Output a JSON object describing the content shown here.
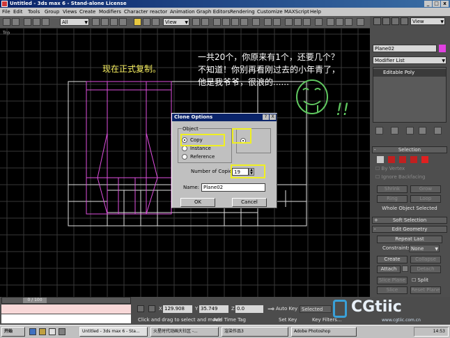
{
  "window": {
    "title": "Untitled - 3ds max 6 - Stand-alone License"
  },
  "menu": [
    "File",
    "Edit",
    "Tools",
    "Group",
    "Views",
    "Create",
    "Modifiers",
    "Character",
    "reactor",
    "Animation",
    "Graph Editors",
    "Rendering",
    "Customize",
    "MAXScript",
    "Help"
  ],
  "toolbar": {
    "selection_filter": "All",
    "ref_coord": "View",
    "ref_coord_right": "View"
  },
  "viewport": {
    "label": "Top",
    "annotation_1": "现在正式复制。",
    "annotation_2": [
      "一共20个，你原来有1个，还要几个？",
      "不知道！你别再看刚过去的小年青了，",
      "他是我爷爷，很浪的......"
    ],
    "doodle": "!!"
  },
  "dialog": {
    "title": "Clone Options",
    "help_btn": "?",
    "close_btn": "X",
    "group_object": "Object",
    "radio_copy": "Copy",
    "radio_instance": "Instance",
    "radio_reference": "Reference",
    "copies_label": "Number of Copies:",
    "copies_value": "19",
    "name_label": "Name:",
    "name_value": "Plane02",
    "ok": "OK",
    "cancel": "Cancel"
  },
  "panel": {
    "object_name": "Plane02",
    "modifier_list": "Modifier List",
    "stack_item": "Editable Poly",
    "selection_title": "Selection",
    "by_vertex": "By Vertex",
    "ignore_backfacing": "Ignore Backfacing",
    "shrink": "Shrink",
    "grow": "Grow",
    "ring": "Ring",
    "loop": "Loop",
    "whole_object": "Whole Object Selected",
    "soft_selection": "Soft Selection",
    "edit_geometry": "Edit Geometry",
    "repeat_last": "Repeat Last",
    "constraints_label": "Constraints:",
    "constraints_value": "None",
    "create": "Create",
    "collapse": "Collapse",
    "attach": "Attach",
    "detach": "Detach",
    "slice_plane": "Slice Plane",
    "split": "Split",
    "slice": "Slice",
    "reset_plane": "Reset Plane",
    "object_color": "#e040e0"
  },
  "status": {
    "time": "0 / 100",
    "x_label": "X",
    "x_value": "129.908",
    "y_label": "Y",
    "y_value": "35.749",
    "z_label": "Z",
    "z_value": "0.0",
    "auto_key": "Auto Key",
    "selected": "Selected",
    "set_key": "Set Key",
    "key_filters": "Key Filters...",
    "prompt": "Click and drag to select and move",
    "add_time_tag": "Add Time Tag"
  },
  "taskbar": {
    "start": "开始",
    "items": [
      "Untitled - 3ds max 6 - Sta...",
      "火星时代动画大社区 -...",
      "渲染作品3",
      "Adobe Photoshop"
    ],
    "clock": "14:53"
  },
  "watermark": {
    "main": "CGtiic",
    "url": "www.cgtiic.com.cn"
  }
}
